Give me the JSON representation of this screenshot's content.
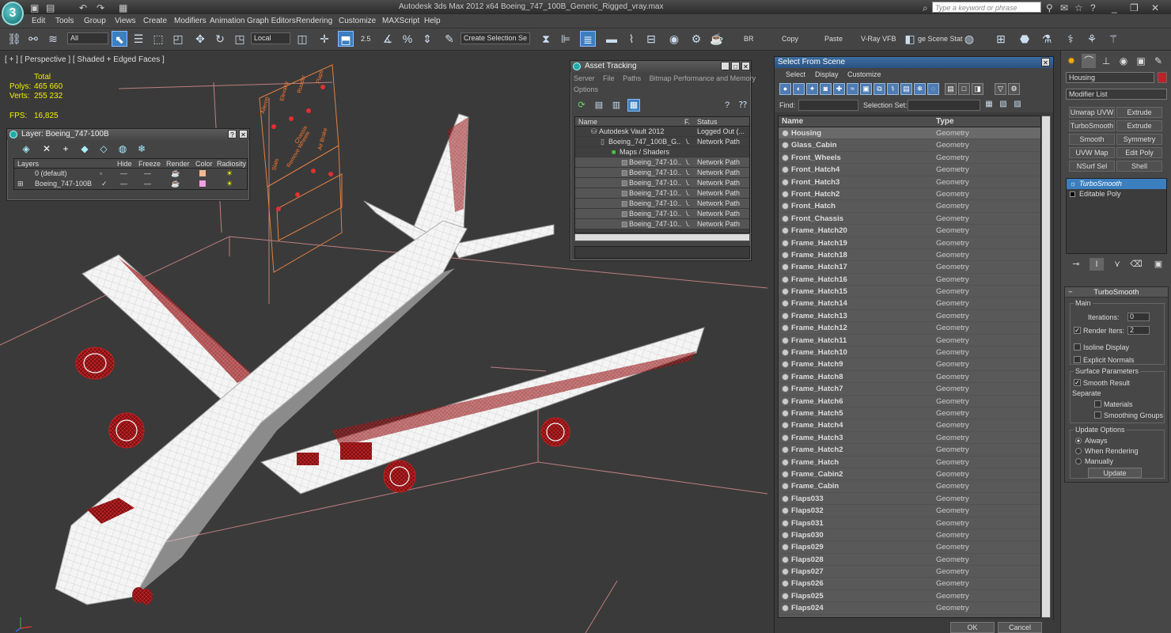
{
  "app": {
    "title": "Autodesk 3ds Max  2012 x64      Boeing_747_100B_Generic_Rigged_vray.max",
    "logo": "3",
    "search_placeholder": "Type a keyword or phrase"
  },
  "menu": [
    "Edit",
    "Tools",
    "Group",
    "Views",
    "Create",
    "Modifiers",
    "Animation",
    "Graph Editors",
    "Rendering",
    "Customize",
    "MAXScript",
    "Help"
  ],
  "toolbar": {
    "filter": "All",
    "coord": "Local",
    "snap_value": "2.5",
    "selection_set": "Create Selection Se",
    "labels": [
      "BR",
      "Copy",
      "Paste",
      "V-Ray VFB",
      "ge Scene Stat"
    ]
  },
  "viewport": {
    "label": "[ + ] [ Perspective ] [ Shaded + Edged Faces ]",
    "stats_header": "Total",
    "polys_label": "Polys:",
    "polys": "465 660",
    "verts_label": "Verts:",
    "verts": "255 232",
    "fps_label": "FPS:",
    "fps": "16,825",
    "panel_labels": [
      "Aileron",
      "Elevator",
      "Rudder",
      "Flaps",
      "Slats",
      "Chassis",
      "Remove Wheels",
      "Air Brake"
    ]
  },
  "layer_dialog": {
    "title": "Layer: Boeing_747-100B",
    "headers": [
      "Layers",
      "Hide",
      "Freeze",
      "Render",
      "Color",
      "Radiosity"
    ],
    "rows": [
      {
        "name": "0 (default)",
        "color": "#f0b890"
      },
      {
        "name": "Boeing_747-100B",
        "color": "#f0a0e0"
      }
    ]
  },
  "asset_tracking": {
    "title": "Asset Tracking",
    "menu": [
      "Server",
      "File",
      "Paths",
      "Bitmap Performance and Memory"
    ],
    "menu2": "Options",
    "headers": [
      "Name",
      "F.",
      "Status"
    ],
    "rows": [
      {
        "name": "Autodesk Vault 2012",
        "f": "",
        "status": "Logged Out (..."
      },
      {
        "name": "Boeing_747_100B_G...",
        "f": "\\.",
        "status": "Network Path"
      },
      {
        "name": "Maps / Shaders",
        "f": "",
        "status": ""
      },
      {
        "name": "Boeing_747-10...",
        "f": "\\.",
        "status": "Network Path"
      },
      {
        "name": "Boeing_747-10...",
        "f": "\\.",
        "status": "Network Path"
      },
      {
        "name": "Boeing_747-10...",
        "f": "\\.",
        "status": "Network Path"
      },
      {
        "name": "Boeing_747-10...",
        "f": "\\.",
        "status": "Network Path"
      },
      {
        "name": "Boeing_747-10...",
        "f": "\\.",
        "status": "Network Path"
      },
      {
        "name": "Boeing_747-10...",
        "f": "\\.",
        "status": "Network Path"
      },
      {
        "name": "Boeing_747-10...",
        "f": "\\.",
        "status": "Network Path"
      }
    ]
  },
  "select_from_scene": {
    "title": "Select From Scene",
    "menu": [
      "Select",
      "Display",
      "Customize"
    ],
    "find_label": "Find:",
    "selection_set_label": "Selection Set:",
    "col_name": "Name",
    "col_type": "Type",
    "ok": "OK",
    "cancel": "Cancel",
    "rows": [
      {
        "name": "Housing",
        "type": "Geometry"
      },
      {
        "name": "Glass_Cabin",
        "type": "Geometry"
      },
      {
        "name": "Front_Wheels",
        "type": "Geometry"
      },
      {
        "name": "Front_Hatch4",
        "type": "Geometry"
      },
      {
        "name": "Front_Hatch3",
        "type": "Geometry"
      },
      {
        "name": "Front_Hatch2",
        "type": "Geometry"
      },
      {
        "name": "Front_Hatch",
        "type": "Geometry"
      },
      {
        "name": "Front_Chassis",
        "type": "Geometry"
      },
      {
        "name": "Frame_Hatch20",
        "type": "Geometry"
      },
      {
        "name": "Frame_Hatch19",
        "type": "Geometry"
      },
      {
        "name": "Frame_Hatch18",
        "type": "Geometry"
      },
      {
        "name": "Frame_Hatch17",
        "type": "Geometry"
      },
      {
        "name": "Frame_Hatch16",
        "type": "Geometry"
      },
      {
        "name": "Frame_Hatch15",
        "type": "Geometry"
      },
      {
        "name": "Frame_Hatch14",
        "type": "Geometry"
      },
      {
        "name": "Frame_Hatch13",
        "type": "Geometry"
      },
      {
        "name": "Frame_Hatch12",
        "type": "Geometry"
      },
      {
        "name": "Frame_Hatch11",
        "type": "Geometry"
      },
      {
        "name": "Frame_Hatch10",
        "type": "Geometry"
      },
      {
        "name": "Frame_Hatch9",
        "type": "Geometry"
      },
      {
        "name": "Frame_Hatch8",
        "type": "Geometry"
      },
      {
        "name": "Frame_Hatch7",
        "type": "Geometry"
      },
      {
        "name": "Frame_Hatch6",
        "type": "Geometry"
      },
      {
        "name": "Frame_Hatch5",
        "type": "Geometry"
      },
      {
        "name": "Frame_Hatch4",
        "type": "Geometry"
      },
      {
        "name": "Frame_Hatch3",
        "type": "Geometry"
      },
      {
        "name": "Frame_Hatch2",
        "type": "Geometry"
      },
      {
        "name": "Frame_Hatch",
        "type": "Geometry"
      },
      {
        "name": "Frame_Cabin2",
        "type": "Geometry"
      },
      {
        "name": "Frame_Cabin",
        "type": "Geometry"
      },
      {
        "name": "Flaps033",
        "type": "Geometry"
      },
      {
        "name": "Flaps032",
        "type": "Geometry"
      },
      {
        "name": "Flaps031",
        "type": "Geometry"
      },
      {
        "name": "Flaps030",
        "type": "Geometry"
      },
      {
        "name": "Flaps029",
        "type": "Geometry"
      },
      {
        "name": "Flaps028",
        "type": "Geometry"
      },
      {
        "name": "Flaps027",
        "type": "Geometry"
      },
      {
        "name": "Flaps026",
        "type": "Geometry"
      },
      {
        "name": "Flaps025",
        "type": "Geometry"
      },
      {
        "name": "Flaps024",
        "type": "Geometry"
      }
    ]
  },
  "command_panel": {
    "object_name": "Housing",
    "object_color": "#c0202a",
    "modifier_list": "Modifier List",
    "buttons": [
      "Unwrap UVW",
      "Extrude",
      "TurboSmooth",
      "Extrude",
      "Smooth",
      "Symmetry",
      "UVW Map",
      "Edit Poly",
      "NSurf Sel",
      "Shell"
    ],
    "stack": [
      "TurboSmooth",
      "Editable Poly"
    ],
    "rollout_title": "TurboSmooth",
    "main_label": "Main",
    "iterations_label": "Iterations:",
    "iterations": "0",
    "render_iters_label": "Render Iters:",
    "render_iters": "2",
    "isoline": "Isoline Display",
    "explicit": "Explicit Normals",
    "surface_params": "Surface Parameters",
    "smooth_result": "Smooth Result",
    "separate": "Separate",
    "materials": "Materials",
    "smoothing_groups": "Smoothing Groups",
    "update_options": "Update Options",
    "always": "Always",
    "when_rendering": "When Rendering",
    "manually": "Manually",
    "update": "Update"
  }
}
